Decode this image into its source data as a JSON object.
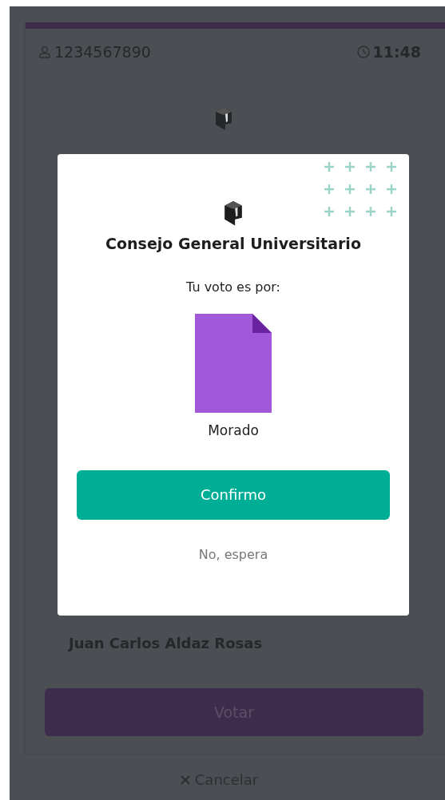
{
  "header": {
    "user_id": "1234567890",
    "time": "11:48"
  },
  "background": {
    "candidate": "Juan Carlos Aldaz Rosas",
    "vote_button": "Votar",
    "cancel_link": "Cancelar"
  },
  "modal": {
    "title": "Consejo General Universitario",
    "prompt": "Tu voto es por:",
    "choice": "Morado",
    "confirm_button": "Confirmo",
    "dismiss_link": "No, espera"
  }
}
